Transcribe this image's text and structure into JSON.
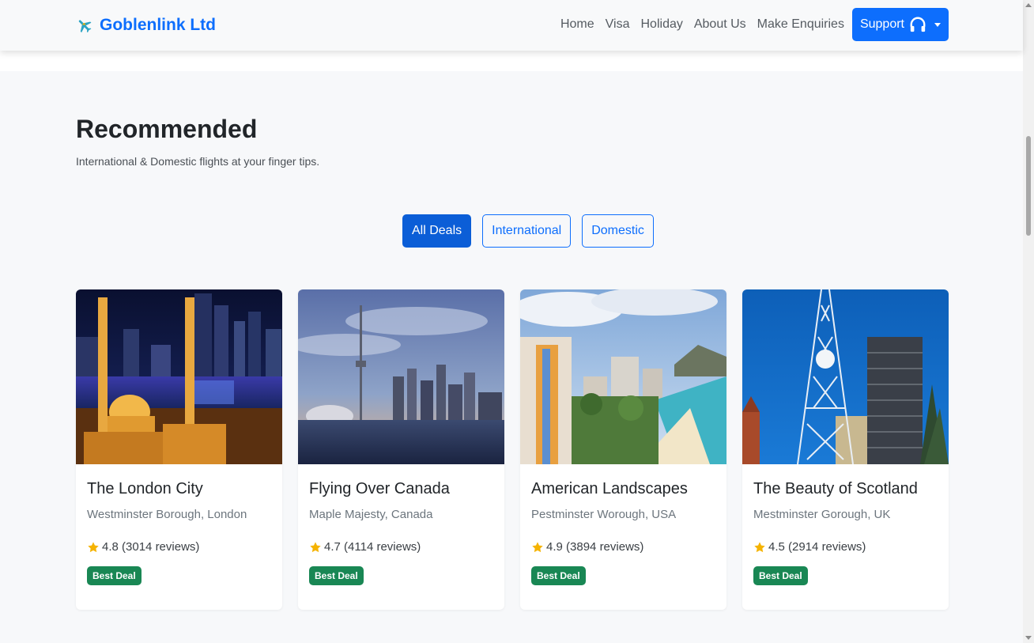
{
  "brand": {
    "name": "Goblenlink Ltd",
    "icon": "airplane-icon",
    "color": "#0d6efd"
  },
  "nav": {
    "links": [
      "Home",
      "Visa",
      "Holiday",
      "About Us",
      "Make Enquiries"
    ],
    "support_label": "Support",
    "support_icon": "headphones-icon"
  },
  "section": {
    "title": "Recommended",
    "subtitle": "International & Domestic flights at your finger tips."
  },
  "filters": {
    "items": [
      "All Deals",
      "International",
      "Domestic"
    ],
    "active": "All Deals"
  },
  "cards": [
    {
      "title": "The London City",
      "location": "Westminster Borough, London",
      "rating": "4.8",
      "reviews": "(3014 reviews)",
      "badge": "Best Deal",
      "image": "night-city-mosque-image"
    },
    {
      "title": "Flying Over Canada",
      "location": "Maple Majesty, Canada",
      "rating": "4.7",
      "reviews": "(4114 reviews)",
      "badge": "Best Deal",
      "image": "toronto-skyline-image"
    },
    {
      "title": "American Landscapes",
      "location": "Pestminster Worough, USA",
      "rating": "4.9",
      "reviews": "(3894 reviews)",
      "badge": "Best Deal",
      "image": "beach-hotels-image"
    },
    {
      "title": "The Beauty of Scotland",
      "location": "Mestminster Gorough, UK",
      "rating": "4.5",
      "reviews": "(2914 reviews)",
      "badge": "Best Deal",
      "image": "lattice-tower-image"
    }
  ],
  "colors": {
    "primary": "#0d6efd",
    "active": "#0b5ed7",
    "badge": "#198754",
    "star": "#f5b301"
  }
}
